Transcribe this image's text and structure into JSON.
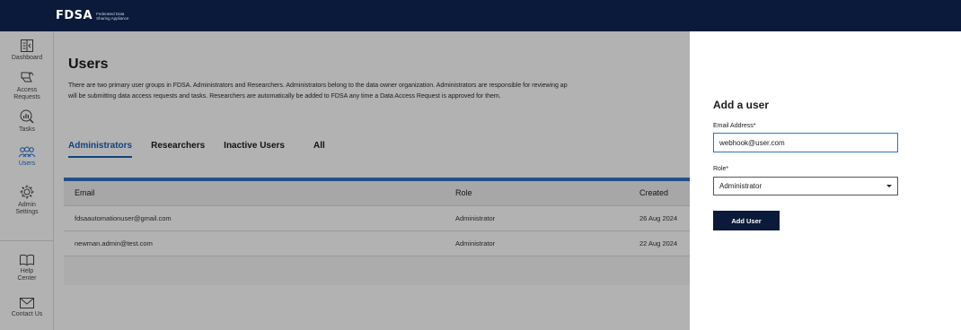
{
  "header": {
    "logo": "FDSA",
    "logo_sub_line1": "Federated Data",
    "logo_sub_line2": "Sharing Appliance"
  },
  "sidebar": {
    "items": [
      {
        "label_line1": "Dashboard",
        "label_line2": "",
        "icon": "dashboard-icon"
      },
      {
        "label_line1": "Access",
        "label_line2": "Requests",
        "icon": "access-requests-icon"
      },
      {
        "label_line1": "Tasks",
        "label_line2": "",
        "icon": "tasks-icon"
      },
      {
        "label_line1": "Users",
        "label_line2": "",
        "icon": "users-icon",
        "active": true
      },
      {
        "label_line1": "Admin",
        "label_line2": "Settings",
        "icon": "gear-icon"
      },
      {
        "label_line1": "Help",
        "label_line2": "Center",
        "icon": "book-icon"
      },
      {
        "label_line1": "Contact Us",
        "label_line2": "",
        "icon": "envelope-icon"
      }
    ]
  },
  "main": {
    "title": "Users",
    "description_line1": "There are two primary user groups in FDSA. Administrators and Researchers. Administrators belong to the data owner organization. Administrators are responsible for reviewing ap",
    "description_line2": "will be submitting data access requests and tasks. Researchers are automatically be added to FDSA any time a Data Access Request is approved for them.",
    "tabs": [
      "Administrators",
      "Researchers",
      "Inactive Users",
      "All"
    ],
    "active_tab": "Administrators",
    "table": {
      "columns": [
        "Email",
        "Role",
        "Created"
      ],
      "rows": [
        [
          "fdsaautomationuser@gmail.com",
          "Administrator",
          "26 Aug 2024"
        ],
        [
          "newman.admin@test.com",
          "Administrator",
          "22 Aug 2024"
        ]
      ]
    }
  },
  "drawer": {
    "title": "Add a user",
    "email_label": "Email Address*",
    "email_value": "webhook@user.com",
    "role_label": "Role*",
    "role_value": "Administrator",
    "submit_label": "Add User"
  },
  "colors": {
    "header_bg": "#0b1a3a",
    "accent": "#1a5fb4",
    "table_accent": "#2f73c4"
  }
}
